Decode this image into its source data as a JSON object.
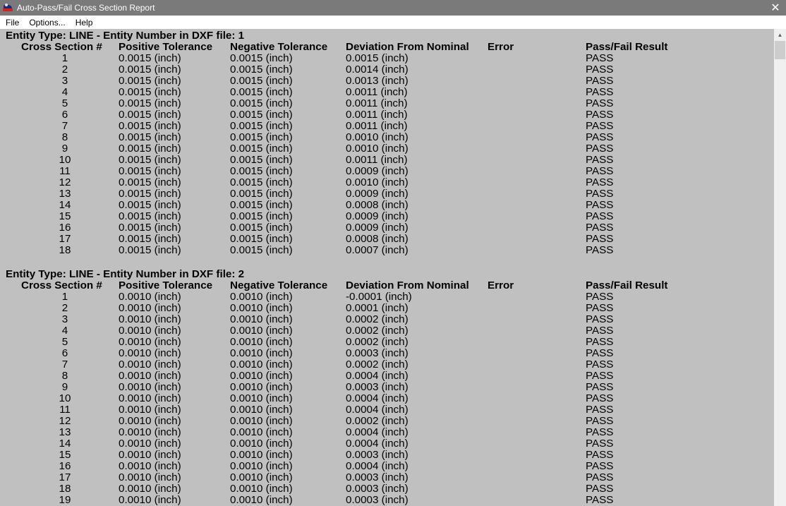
{
  "window": {
    "title": "Auto-Pass/Fail Cross Section Report"
  },
  "menu": {
    "items": [
      "File",
      "Options...",
      "Help"
    ]
  },
  "report": {
    "columns": [
      "Cross Section #",
      "Positive Tolerance",
      "Negative Tolerance",
      "Deviation From Nominal",
      "Error",
      "Pass/Fail Result"
    ],
    "sections": [
      {
        "header": "Entity Type: LINE - Entity Number in DXF file: 1",
        "rows": [
          [
            "1",
            "0.0015 (inch)",
            "0.0015 (inch)",
            "0.0015 (inch)",
            "",
            "PASS"
          ],
          [
            "2",
            "0.0015 (inch)",
            "0.0015 (inch)",
            "0.0014 (inch)",
            "",
            "PASS"
          ],
          [
            "3",
            "0.0015 (inch)",
            "0.0015 (inch)",
            "0.0013 (inch)",
            "",
            "PASS"
          ],
          [
            "4",
            "0.0015 (inch)",
            "0.0015 (inch)",
            "0.0011 (inch)",
            "",
            "PASS"
          ],
          [
            "5",
            "0.0015 (inch)",
            "0.0015 (inch)",
            "0.0011 (inch)",
            "",
            "PASS"
          ],
          [
            "6",
            "0.0015 (inch)",
            "0.0015 (inch)",
            "0.0011 (inch)",
            "",
            "PASS"
          ],
          [
            "7",
            "0.0015 (inch)",
            "0.0015 (inch)",
            "0.0011 (inch)",
            "",
            "PASS"
          ],
          [
            "8",
            "0.0015 (inch)",
            "0.0015 (inch)",
            "0.0010 (inch)",
            "",
            "PASS"
          ],
          [
            "9",
            "0.0015 (inch)",
            "0.0015 (inch)",
            "0.0010 (inch)",
            "",
            "PASS"
          ],
          [
            "10",
            "0.0015 (inch)",
            "0.0015 (inch)",
            "0.0011 (inch)",
            "",
            "PASS"
          ],
          [
            "11",
            "0.0015 (inch)",
            "0.0015 (inch)",
            "0.0009 (inch)",
            "",
            "PASS"
          ],
          [
            "12",
            "0.0015 (inch)",
            "0.0015 (inch)",
            "0.0010 (inch)",
            "",
            "PASS"
          ],
          [
            "13",
            "0.0015 (inch)",
            "0.0015 (inch)",
            "0.0009 (inch)",
            "",
            "PASS"
          ],
          [
            "14",
            "0.0015 (inch)",
            "0.0015 (inch)",
            "0.0008 (inch)",
            "",
            "PASS"
          ],
          [
            "15",
            "0.0015 (inch)",
            "0.0015 (inch)",
            "0.0009 (inch)",
            "",
            "PASS"
          ],
          [
            "16",
            "0.0015 (inch)",
            "0.0015 (inch)",
            "0.0009 (inch)",
            "",
            "PASS"
          ],
          [
            "17",
            "0.0015 (inch)",
            "0.0015 (inch)",
            "0.0008 (inch)",
            "",
            "PASS"
          ],
          [
            "18",
            "0.0015 (inch)",
            "0.0015 (inch)",
            "0.0007 (inch)",
            "",
            "PASS"
          ]
        ]
      },
      {
        "header": "Entity Type: LINE - Entity Number in DXF file: 2",
        "rows": [
          [
            "1",
            "0.0010 (inch)",
            "0.0010 (inch)",
            "-0.0001 (inch)",
            "",
            "PASS"
          ],
          [
            "2",
            "0.0010 (inch)",
            "0.0010 (inch)",
            "0.0001 (inch)",
            "",
            "PASS"
          ],
          [
            "3",
            "0.0010 (inch)",
            "0.0010 (inch)",
            "0.0002 (inch)",
            "",
            "PASS"
          ],
          [
            "4",
            "0.0010 (inch)",
            "0.0010 (inch)",
            "0.0002 (inch)",
            "",
            "PASS"
          ],
          [
            "5",
            "0.0010 (inch)",
            "0.0010 (inch)",
            "0.0002 (inch)",
            "",
            "PASS"
          ],
          [
            "6",
            "0.0010 (inch)",
            "0.0010 (inch)",
            "0.0003 (inch)",
            "",
            "PASS"
          ],
          [
            "7",
            "0.0010 (inch)",
            "0.0010 (inch)",
            "0.0002 (inch)",
            "",
            "PASS"
          ],
          [
            "8",
            "0.0010 (inch)",
            "0.0010 (inch)",
            "0.0004 (inch)",
            "",
            "PASS"
          ],
          [
            "9",
            "0.0010 (inch)",
            "0.0010 (inch)",
            "0.0003 (inch)",
            "",
            "PASS"
          ],
          [
            "10",
            "0.0010 (inch)",
            "0.0010 (inch)",
            "0.0004 (inch)",
            "",
            "PASS"
          ],
          [
            "11",
            "0.0010 (inch)",
            "0.0010 (inch)",
            "0.0004 (inch)",
            "",
            "PASS"
          ],
          [
            "12",
            "0.0010 (inch)",
            "0.0010 (inch)",
            "0.0002 (inch)",
            "",
            "PASS"
          ],
          [
            "13",
            "0.0010 (inch)",
            "0.0010 (inch)",
            "0.0004 (inch)",
            "",
            "PASS"
          ],
          [
            "14",
            "0.0010 (inch)",
            "0.0010 (inch)",
            "0.0004 (inch)",
            "",
            "PASS"
          ],
          [
            "15",
            "0.0010 (inch)",
            "0.0010 (inch)",
            "0.0003 (inch)",
            "",
            "PASS"
          ],
          [
            "16",
            "0.0010 (inch)",
            "0.0010 (inch)",
            "0.0004 (inch)",
            "",
            "PASS"
          ],
          [
            "17",
            "0.0010 (inch)",
            "0.0010 (inch)",
            "0.0003 (inch)",
            "",
            "PASS"
          ],
          [
            "18",
            "0.0010 (inch)",
            "0.0010 (inch)",
            "0.0003 (inch)",
            "",
            "PASS"
          ],
          [
            "19",
            "0.0010 (inch)",
            "0.0010 (inch)",
            "0.0003 (inch)",
            "",
            "PASS"
          ]
        ]
      }
    ]
  },
  "colors": {
    "titlebar_bg": "#7a7a7a",
    "report_bg": "#c0c0c0",
    "menubar_bg": "#ffffff"
  },
  "icons": {
    "app": "app-icon",
    "close": "close-icon",
    "scroll_up": "scroll-up-arrow-icon"
  }
}
